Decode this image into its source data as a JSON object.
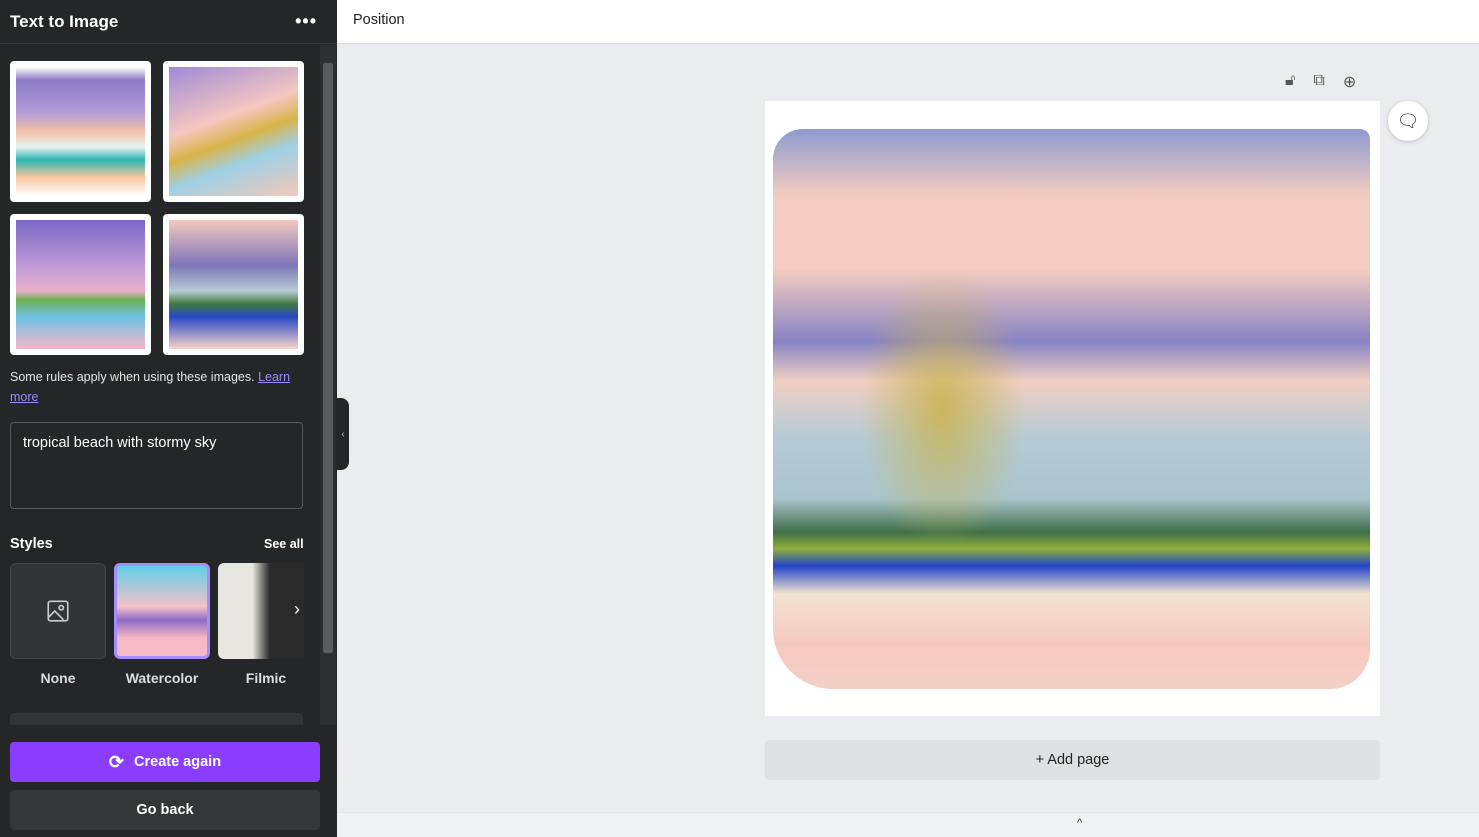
{
  "panel": {
    "title": "Text to Image",
    "more_icon": "more-horizontal-icon",
    "rules_text": "Some rules apply when using these images. ",
    "learn_more": "Learn more",
    "prompt": "tropical beach with stormy sky",
    "styles_title": "Styles",
    "see_all": "See all",
    "styles": [
      {
        "label": "None"
      },
      {
        "label": "Watercolor",
        "selected": true
      },
      {
        "label": "Filmic"
      }
    ],
    "create_again": "Create again",
    "go_back": "Go back",
    "accent": "#8b3dff"
  },
  "topbar": {
    "position": "Position"
  },
  "canvas": {
    "add_page": "+ Add page"
  }
}
